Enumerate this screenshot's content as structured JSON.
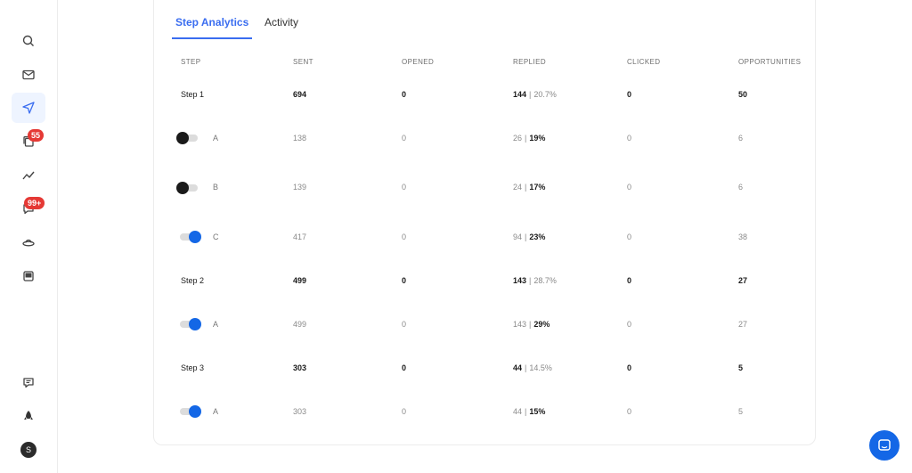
{
  "tabs": [
    "Step Analytics",
    "Activity"
  ],
  "columns": [
    "STEP",
    "SENT",
    "OPENED",
    "REPLIED",
    "CLICKED",
    "OPPORTUNITIES"
  ],
  "sidebar": {
    "icons": [
      "search-icon",
      "mail-icon",
      "send-icon",
      "copy-icon",
      "analytics-icon",
      "chat-icon",
      "ufo-icon",
      "inbox-icon",
      "feedback-icon",
      "rocket-icon"
    ],
    "badges": {
      "copy": "55",
      "chat": "99+"
    },
    "avatar_initial": "S"
  },
  "rows": [
    {
      "type": "step",
      "label": "Step 1",
      "sent": "694",
      "opened": "0",
      "replied": "144",
      "replied_pct": "20.7%",
      "clicked": "0",
      "opportunities": "50"
    },
    {
      "type": "variant",
      "label": "A",
      "toggle": "off",
      "sent": "138",
      "opened": "0",
      "replied": "26",
      "replied_pct": "19%",
      "clicked": "0",
      "opportunities": "6"
    },
    {
      "type": "variant",
      "label": "B",
      "toggle": "off",
      "sent": "139",
      "opened": "0",
      "replied": "24",
      "replied_pct": "17%",
      "clicked": "0",
      "opportunities": "6"
    },
    {
      "type": "variant",
      "label": "C",
      "toggle": "on",
      "sent": "417",
      "opened": "0",
      "replied": "94",
      "replied_pct": "23%",
      "clicked": "0",
      "opportunities": "38"
    },
    {
      "type": "step",
      "label": "Step 2",
      "sent": "499",
      "opened": "0",
      "replied": "143",
      "replied_pct": "28.7%",
      "clicked": "0",
      "opportunities": "27"
    },
    {
      "type": "variant",
      "label": "A",
      "toggle": "on",
      "sent": "499",
      "opened": "0",
      "replied": "143",
      "replied_pct": "29%",
      "clicked": "0",
      "opportunities": "27"
    },
    {
      "type": "step",
      "label": "Step 3",
      "sent": "303",
      "opened": "0",
      "replied": "44",
      "replied_pct": "14.5%",
      "clicked": "0",
      "opportunities": "5"
    },
    {
      "type": "variant",
      "label": "A",
      "toggle": "on",
      "sent": "303",
      "opened": "0",
      "replied": "44",
      "replied_pct": "15%",
      "clicked": "0",
      "opportunities": "5"
    }
  ],
  "colors": {
    "accent": "#3a6df0",
    "toggle_on": "#1467e6",
    "badge": "#e53935"
  }
}
